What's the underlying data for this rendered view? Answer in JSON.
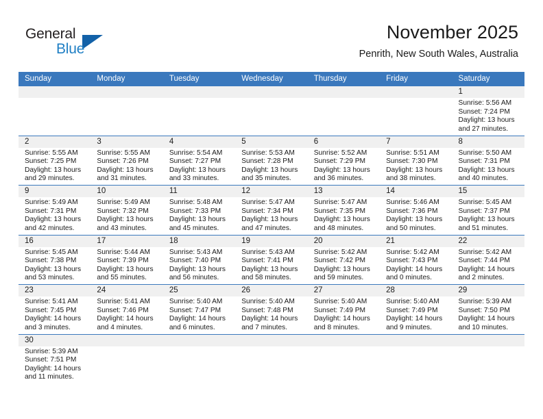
{
  "brand": {
    "name_part1": "General",
    "name_part2": "Blue",
    "triangle_color": "#1261a8",
    "blue_color": "#1f7fc4"
  },
  "header": {
    "title": "November 2025",
    "location": "Penrith, New South Wales, Australia"
  },
  "theme": {
    "header_row_bg": "#3a78bd",
    "day_band_bg": "#f0f0f0",
    "row_divider": "#3a78bd"
  },
  "weekdays": [
    "Sunday",
    "Monday",
    "Tuesday",
    "Wednesday",
    "Thursday",
    "Friday",
    "Saturday"
  ],
  "labels": {
    "sunrise_prefix": "Sunrise: ",
    "sunset_prefix": "Sunset: ",
    "daylight_prefix": "Daylight: "
  },
  "weeks": [
    [
      {
        "empty": true
      },
      {
        "empty": true
      },
      {
        "empty": true
      },
      {
        "empty": true
      },
      {
        "empty": true
      },
      {
        "empty": true
      },
      {
        "day": "1",
        "sunrise": "Sunrise: 5:56 AM",
        "sunset": "Sunset: 7:24 PM",
        "daylight_line1": "Daylight: 13 hours",
        "daylight_line2": "and 27 minutes."
      }
    ],
    [
      {
        "day": "2",
        "sunrise": "Sunrise: 5:55 AM",
        "sunset": "Sunset: 7:25 PM",
        "daylight_line1": "Daylight: 13 hours",
        "daylight_line2": "and 29 minutes."
      },
      {
        "day": "3",
        "sunrise": "Sunrise: 5:55 AM",
        "sunset": "Sunset: 7:26 PM",
        "daylight_line1": "Daylight: 13 hours",
        "daylight_line2": "and 31 minutes."
      },
      {
        "day": "4",
        "sunrise": "Sunrise: 5:54 AM",
        "sunset": "Sunset: 7:27 PM",
        "daylight_line1": "Daylight: 13 hours",
        "daylight_line2": "and 33 minutes."
      },
      {
        "day": "5",
        "sunrise": "Sunrise: 5:53 AM",
        "sunset": "Sunset: 7:28 PM",
        "daylight_line1": "Daylight: 13 hours",
        "daylight_line2": "and 35 minutes."
      },
      {
        "day": "6",
        "sunrise": "Sunrise: 5:52 AM",
        "sunset": "Sunset: 7:29 PM",
        "daylight_line1": "Daylight: 13 hours",
        "daylight_line2": "and 36 minutes."
      },
      {
        "day": "7",
        "sunrise": "Sunrise: 5:51 AM",
        "sunset": "Sunset: 7:30 PM",
        "daylight_line1": "Daylight: 13 hours",
        "daylight_line2": "and 38 minutes."
      },
      {
        "day": "8",
        "sunrise": "Sunrise: 5:50 AM",
        "sunset": "Sunset: 7:31 PM",
        "daylight_line1": "Daylight: 13 hours",
        "daylight_line2": "and 40 minutes."
      }
    ],
    [
      {
        "day": "9",
        "sunrise": "Sunrise: 5:49 AM",
        "sunset": "Sunset: 7:31 PM",
        "daylight_line1": "Daylight: 13 hours",
        "daylight_line2": "and 42 minutes."
      },
      {
        "day": "10",
        "sunrise": "Sunrise: 5:49 AM",
        "sunset": "Sunset: 7:32 PM",
        "daylight_line1": "Daylight: 13 hours",
        "daylight_line2": "and 43 minutes."
      },
      {
        "day": "11",
        "sunrise": "Sunrise: 5:48 AM",
        "sunset": "Sunset: 7:33 PM",
        "daylight_line1": "Daylight: 13 hours",
        "daylight_line2": "and 45 minutes."
      },
      {
        "day": "12",
        "sunrise": "Sunrise: 5:47 AM",
        "sunset": "Sunset: 7:34 PM",
        "daylight_line1": "Daylight: 13 hours",
        "daylight_line2": "and 47 minutes."
      },
      {
        "day": "13",
        "sunrise": "Sunrise: 5:47 AM",
        "sunset": "Sunset: 7:35 PM",
        "daylight_line1": "Daylight: 13 hours",
        "daylight_line2": "and 48 minutes."
      },
      {
        "day": "14",
        "sunrise": "Sunrise: 5:46 AM",
        "sunset": "Sunset: 7:36 PM",
        "daylight_line1": "Daylight: 13 hours",
        "daylight_line2": "and 50 minutes."
      },
      {
        "day": "15",
        "sunrise": "Sunrise: 5:45 AM",
        "sunset": "Sunset: 7:37 PM",
        "daylight_line1": "Daylight: 13 hours",
        "daylight_line2": "and 51 minutes."
      }
    ],
    [
      {
        "day": "16",
        "sunrise": "Sunrise: 5:45 AM",
        "sunset": "Sunset: 7:38 PM",
        "daylight_line1": "Daylight: 13 hours",
        "daylight_line2": "and 53 minutes."
      },
      {
        "day": "17",
        "sunrise": "Sunrise: 5:44 AM",
        "sunset": "Sunset: 7:39 PM",
        "daylight_line1": "Daylight: 13 hours",
        "daylight_line2": "and 55 minutes."
      },
      {
        "day": "18",
        "sunrise": "Sunrise: 5:43 AM",
        "sunset": "Sunset: 7:40 PM",
        "daylight_line1": "Daylight: 13 hours",
        "daylight_line2": "and 56 minutes."
      },
      {
        "day": "19",
        "sunrise": "Sunrise: 5:43 AM",
        "sunset": "Sunset: 7:41 PM",
        "daylight_line1": "Daylight: 13 hours",
        "daylight_line2": "and 58 minutes."
      },
      {
        "day": "20",
        "sunrise": "Sunrise: 5:42 AM",
        "sunset": "Sunset: 7:42 PM",
        "daylight_line1": "Daylight: 13 hours",
        "daylight_line2": "and 59 minutes."
      },
      {
        "day": "21",
        "sunrise": "Sunrise: 5:42 AM",
        "sunset": "Sunset: 7:43 PM",
        "daylight_line1": "Daylight: 14 hours",
        "daylight_line2": "and 0 minutes."
      },
      {
        "day": "22",
        "sunrise": "Sunrise: 5:42 AM",
        "sunset": "Sunset: 7:44 PM",
        "daylight_line1": "Daylight: 14 hours",
        "daylight_line2": "and 2 minutes."
      }
    ],
    [
      {
        "day": "23",
        "sunrise": "Sunrise: 5:41 AM",
        "sunset": "Sunset: 7:45 PM",
        "daylight_line1": "Daylight: 14 hours",
        "daylight_line2": "and 3 minutes."
      },
      {
        "day": "24",
        "sunrise": "Sunrise: 5:41 AM",
        "sunset": "Sunset: 7:46 PM",
        "daylight_line1": "Daylight: 14 hours",
        "daylight_line2": "and 4 minutes."
      },
      {
        "day": "25",
        "sunrise": "Sunrise: 5:40 AM",
        "sunset": "Sunset: 7:47 PM",
        "daylight_line1": "Daylight: 14 hours",
        "daylight_line2": "and 6 minutes."
      },
      {
        "day": "26",
        "sunrise": "Sunrise: 5:40 AM",
        "sunset": "Sunset: 7:48 PM",
        "daylight_line1": "Daylight: 14 hours",
        "daylight_line2": "and 7 minutes."
      },
      {
        "day": "27",
        "sunrise": "Sunrise: 5:40 AM",
        "sunset": "Sunset: 7:49 PM",
        "daylight_line1": "Daylight: 14 hours",
        "daylight_line2": "and 8 minutes."
      },
      {
        "day": "28",
        "sunrise": "Sunrise: 5:40 AM",
        "sunset": "Sunset: 7:49 PM",
        "daylight_line1": "Daylight: 14 hours",
        "daylight_line2": "and 9 minutes."
      },
      {
        "day": "29",
        "sunrise": "Sunrise: 5:39 AM",
        "sunset": "Sunset: 7:50 PM",
        "daylight_line1": "Daylight: 14 hours",
        "daylight_line2": "and 10 minutes."
      }
    ],
    [
      {
        "day": "30",
        "sunrise": "Sunrise: 5:39 AM",
        "sunset": "Sunset: 7:51 PM",
        "daylight_line1": "Daylight: 14 hours",
        "daylight_line2": "and 11 minutes."
      },
      {
        "empty": true
      },
      {
        "empty": true
      },
      {
        "empty": true
      },
      {
        "empty": true
      },
      {
        "empty": true
      },
      {
        "empty": true
      }
    ]
  ]
}
